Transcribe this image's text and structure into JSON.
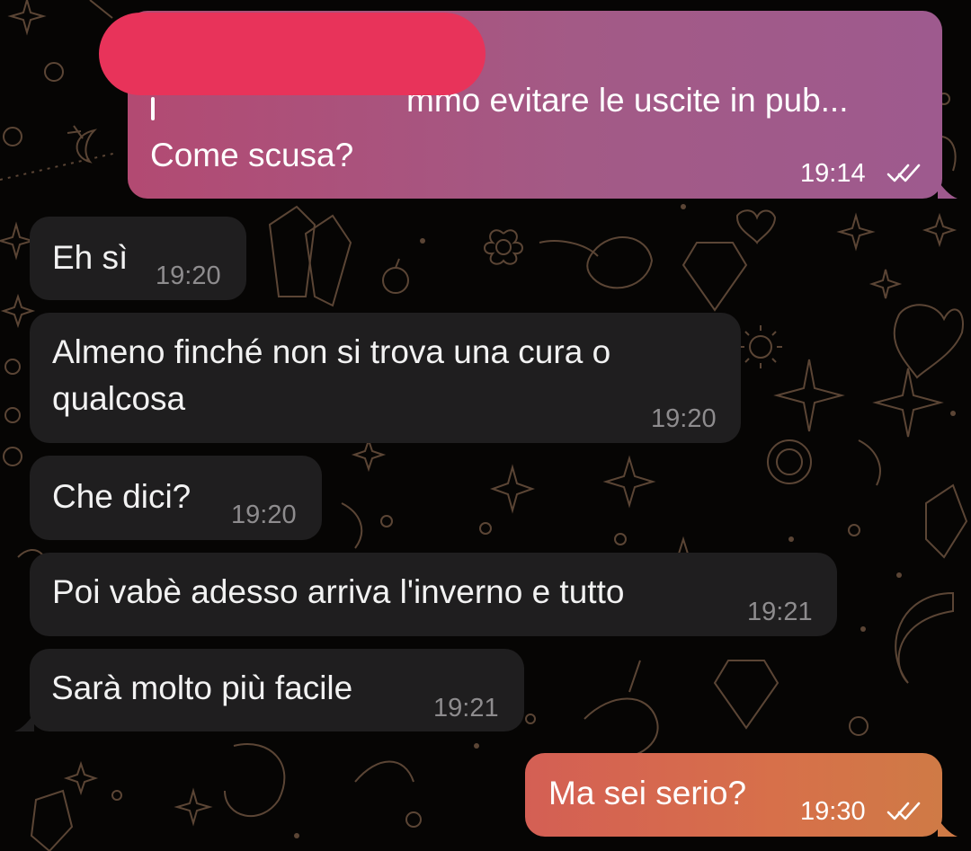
{
  "chat": {
    "messages": [
      {
        "id": "m1",
        "direction": "outgoing",
        "reply_preview": "mmo evitare le uscite in pub...",
        "text": "Come scusa?",
        "time": "19:14",
        "read": true
      },
      {
        "id": "m2",
        "direction": "incoming",
        "text": "Eh sì",
        "time": "19:20"
      },
      {
        "id": "m3",
        "direction": "incoming",
        "text_line1": "Almeno finché non si trova una cura o",
        "text_line2": "qualcosa",
        "time": "19:20"
      },
      {
        "id": "m4",
        "direction": "incoming",
        "text": "Che dici?",
        "time": "19:20"
      },
      {
        "id": "m5",
        "direction": "incoming",
        "text": "Poi vabè adesso arriva l'inverno e tutto",
        "time": "19:21"
      },
      {
        "id": "m6",
        "direction": "incoming",
        "text": "Sarà molto più facile",
        "time": "19:21"
      },
      {
        "id": "m7",
        "direction": "outgoing",
        "text": "Ma sei serio?",
        "time": "19:30",
        "read": true
      }
    ]
  },
  "colors": {
    "background": "#060504",
    "doodle": "#5b4535",
    "incoming_bubble": "#1f1e1f",
    "outgoing_top_gradient_start": "#b24a72",
    "outgoing_top_gradient_end": "#9e5a8e",
    "outgoing_bottom_gradient_start": "#d45f54",
    "outgoing_bottom_gradient_end": "#cf7a46",
    "redaction": "#e8335a"
  },
  "icons": {
    "read_receipt": "double-check-icon"
  }
}
